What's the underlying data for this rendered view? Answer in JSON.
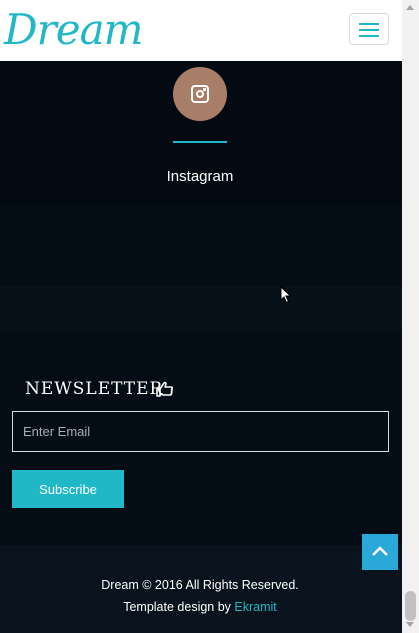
{
  "header": {
    "logo_text": "Dream",
    "menu_icon": "hamburger-menu-icon"
  },
  "team": {
    "social_icon": "instagram-icon",
    "social_label": "Instagram",
    "accent_color": "#20b8c6",
    "icon_bg_color": "#a97e68"
  },
  "newsletter": {
    "title": "NEWSLETTER",
    "title_icon": "hand-pointer-icon",
    "email_placeholder": "Enter Email",
    "email_value": "",
    "subscribe_label": "Subscribe"
  },
  "footer": {
    "copyright": "Dream © 2016 All Rights Reserved.",
    "credit_prefix": "Template design by ",
    "credit_link": "Ekramit",
    "back_to_top_icon": "chevron-up-icon"
  },
  "colors": {
    "background": "#040d15",
    "accent": "#20b8c6",
    "back_to_top": "#2aa9d8"
  }
}
